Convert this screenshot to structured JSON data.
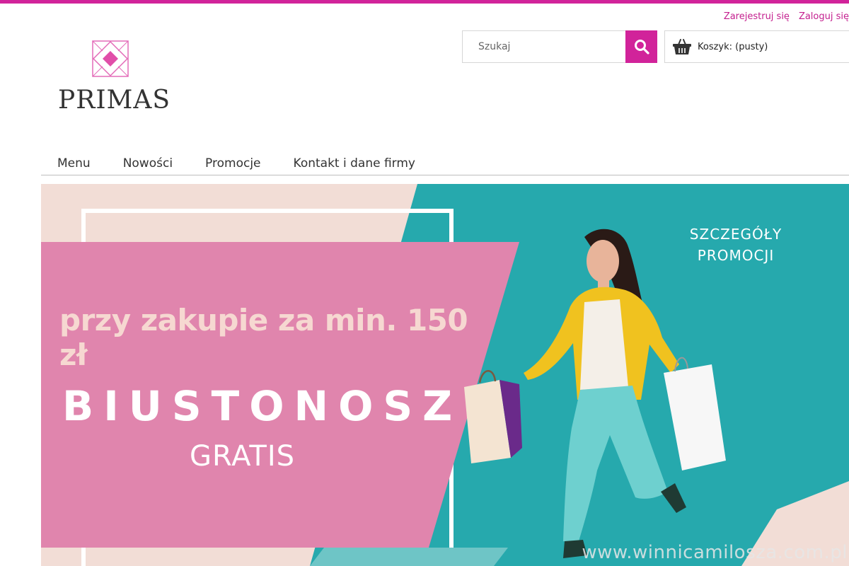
{
  "header": {
    "register_label": "Zarejestruj się",
    "login_label": "Zaloguj się",
    "logo_text": "PRIMAS",
    "search_placeholder": "Szukaj",
    "cart_label": "Koszyk: (pusty)"
  },
  "nav": {
    "items": [
      {
        "label": "Menu"
      },
      {
        "label": "Nowości"
      },
      {
        "label": "Promocje"
      },
      {
        "label": "Kontakt i dane firmy"
      }
    ]
  },
  "banner": {
    "promo_line": "przy zakupie za min. 150 zł",
    "product": "BIUSTONOSZ",
    "gratis": "GRATIS",
    "details_line1": "SZCZEGÓŁY",
    "details_line2": "PROMOCJI",
    "watermark": "www.winnicamilosza.com.pl"
  },
  "colors": {
    "accent": "#d1239a",
    "banner_pink": "#e085ad",
    "banner_teal": "#26a9ad",
    "banner_peach": "#f2ddd6"
  },
  "icons": [
    "logo-diamond-icon",
    "search-icon",
    "basket-icon"
  ]
}
